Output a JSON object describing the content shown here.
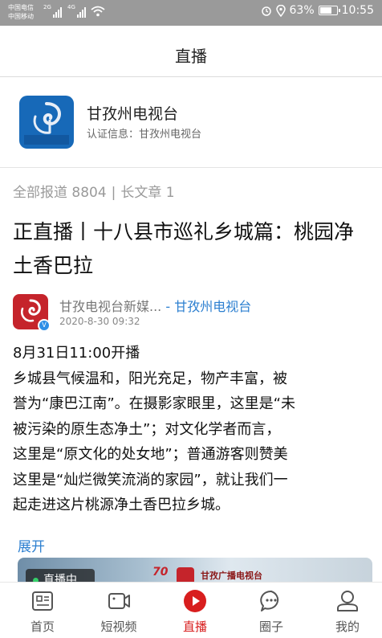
{
  "status_bar": {
    "carrier_1": "中国电信",
    "carrier_2": "中国移动",
    "net_1": "2G",
    "net_2": "4G",
    "battery": "63%",
    "time": "10:55"
  },
  "header": {
    "title": "直播"
  },
  "account": {
    "name": "甘孜州电视台",
    "verification": "认证信息：甘孜州电视台"
  },
  "stats": {
    "reports": "全部报道 8804",
    "separator": "|",
    "long_articles": "长文章 1"
  },
  "article": {
    "title": "正直播丨十八县市巡礼乡城篇：桃园净土香巴拉",
    "author_name": "甘孜电视台新媒...",
    "source": " - 甘孜州电视台",
    "time": "2020-8-30 09:32",
    "body_lines": [
      "8月31日11:00开播",
      "乡城县气候温和，阳光充足，物产丰富，被",
      "誉为“康巴江南”。在摄影家眼里，这里是“未",
      "被污染的原生态净土”；对文化学者而言，",
      "这里是“原文化的处女地”；普通游客则赞美",
      "这里是“灿烂微笑流淌的家园”，就让我们一",
      "起走进这片桃源净土香巴拉乡城。"
    ],
    "expand_label": "展开"
  },
  "media": {
    "live_badge": "直播中",
    "channel_label": "甘孜广播电视台",
    "anniversary": "70"
  },
  "tabs": [
    {
      "label": "首页",
      "icon": "home-icon",
      "active": false
    },
    {
      "label": "短视频",
      "icon": "video-icon",
      "active": false
    },
    {
      "label": "直播",
      "icon": "live-play-icon",
      "active": true
    },
    {
      "label": "圈子",
      "icon": "chat-icon",
      "active": false
    },
    {
      "label": "我的",
      "icon": "profile-icon",
      "active": false
    }
  ],
  "colors": {
    "accent_red": "#d81e1e",
    "link_blue": "#2c7fd0",
    "brand_blue": "#1769b8"
  }
}
